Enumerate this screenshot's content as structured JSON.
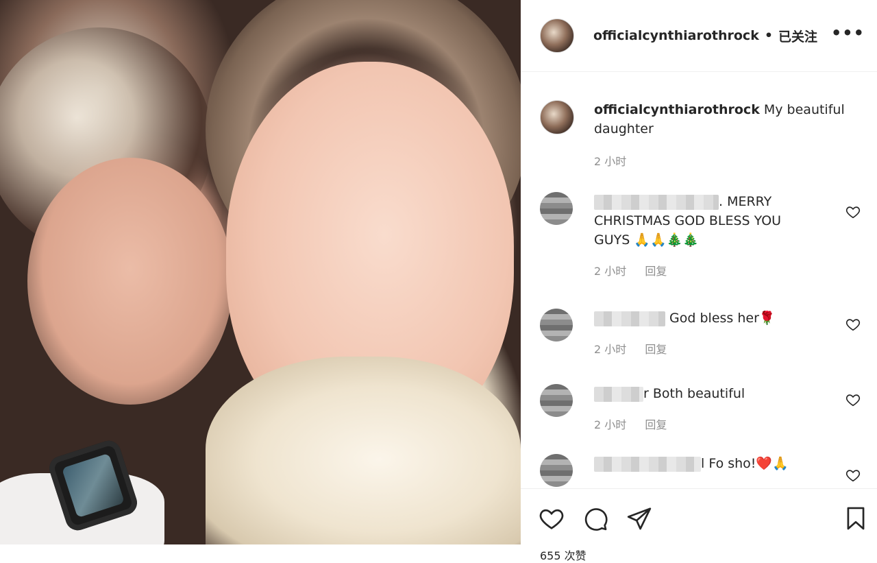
{
  "post": {
    "username": "officialcynthiarothrock",
    "separator": "•",
    "follow_status": "已关注",
    "more_label": "•••"
  },
  "caption": {
    "username": "officialcynthiarothrock",
    "text": "My beautiful daughter",
    "time": "2 小时"
  },
  "comments": [
    {
      "text": ". MERRY CHRISTMAS GOD BLESS YOU GUYS 🙏🙏🎄🎄",
      "time": "2 小时",
      "reply": "回复"
    },
    {
      "text": "God bless her🌹",
      "time": "2 小时",
      "reply": "回复"
    },
    {
      "text": "r Both beautiful",
      "time": "2 小时",
      "reply": "回复"
    },
    {
      "text": "l Fo sho!❤️🙏",
      "time": "",
      "reply": ""
    }
  ],
  "actions": {
    "like_icon": "heart-icon",
    "comment_icon": "comment-icon",
    "share_icon": "share-icon",
    "save_icon": "bookmark-icon"
  },
  "likes_text": "655 次赞"
}
